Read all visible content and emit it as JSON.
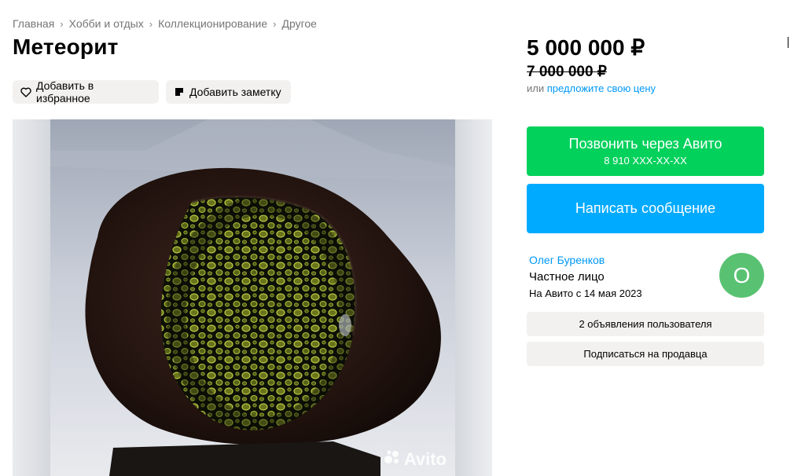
{
  "breadcrumbs": [
    "Главная",
    "Хобби и отдых",
    "Коллекционирование",
    "Другое"
  ],
  "breadcrumb_separator": "›",
  "title": "Метеорит",
  "actions": {
    "favorite_label": "Добавить в избранное",
    "note_label": "Добавить заметку"
  },
  "gallery": {
    "watermark": "Avito"
  },
  "pricing": {
    "price": "5 000 000 ₽",
    "old_price": "7 000 000 ₽",
    "offer_prefix": "или",
    "offer_link": "предложите свою цену"
  },
  "contact": {
    "call_label": "Позвонить через Авито",
    "call_phone": "8 910 XXX-XX-XX",
    "message_label": "Написать сообщение"
  },
  "seller": {
    "name": "Олег Буренков",
    "type": "Частное лицо",
    "since": "На Авито с 14 мая 2023",
    "avatar_letter": "О",
    "listings_label": "2 объявления пользователя",
    "subscribe_label": "Подписаться на продавца"
  },
  "colors": {
    "call_button": "#02d15c",
    "message_button": "#00aaff",
    "link": "#0099f7",
    "avatar": "#59c272"
  }
}
